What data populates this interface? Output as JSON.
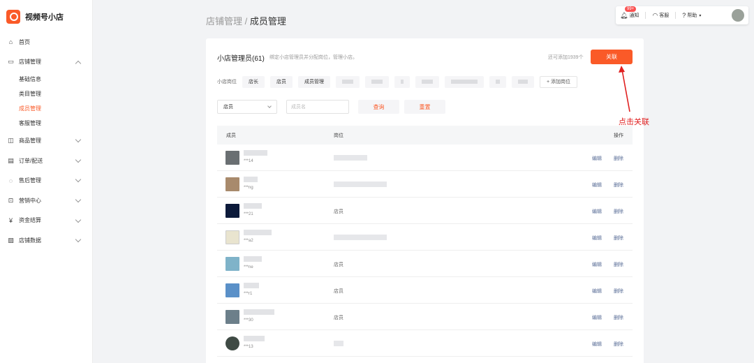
{
  "app": {
    "name": "视频号小店"
  },
  "sidebar": {
    "items": [
      {
        "label": "首页",
        "icon": "home-icon"
      },
      {
        "label": "店铺管理",
        "icon": "store-icon",
        "expanded": true,
        "children": [
          {
            "label": "基础信息",
            "active": false
          },
          {
            "label": "类目管理",
            "active": false
          },
          {
            "label": "成员管理",
            "active": true
          },
          {
            "label": "客服管理",
            "active": false
          }
        ]
      },
      {
        "label": "商品管理",
        "icon": "bag-icon"
      },
      {
        "label": "订单/配送",
        "icon": "order-icon"
      },
      {
        "label": "售后管理",
        "icon": "after-sale-icon"
      },
      {
        "label": "营销中心",
        "icon": "ticket-icon"
      },
      {
        "label": "资金结算",
        "icon": "yen-icon"
      },
      {
        "label": "店铺数据",
        "icon": "chart-icon"
      }
    ]
  },
  "breadcrumb": {
    "parent": "店铺管理",
    "separator": " / ",
    "current": "成员管理"
  },
  "topbar": {
    "notify_label": "通知",
    "notify_badge": "99+",
    "service_label": "客服",
    "help_label": "帮助"
  },
  "card": {
    "title": "小店管理员(61)",
    "desc": "绑定小店管理员并分配岗位，管理小店。",
    "remain": "还可添加1939个",
    "relate_button": "关联",
    "positions_label": "小店岗位",
    "positions": [
      "店长",
      "店员",
      "成员管理"
    ],
    "add_position": "+ 添加岗位",
    "filter": {
      "select_value": "店员",
      "input_placeholder": "成员名",
      "query_button": "查询",
      "reset_button": "重置"
    },
    "table": {
      "col_member": "成员",
      "col_position": "岗位",
      "col_action": "操作",
      "edit_label": "编辑",
      "delete_label": "删除",
      "rows": [
        {
          "suffix": "***14",
          "position": ""
        },
        {
          "suffix": "***ng",
          "position": ""
        },
        {
          "suffix": "***21",
          "position": "店员"
        },
        {
          "suffix": "***a2",
          "position": ""
        },
        {
          "suffix": "***ne",
          "position": "店员"
        },
        {
          "suffix": "***r1",
          "position": "店员"
        },
        {
          "suffix": "***30",
          "position": "店员"
        },
        {
          "suffix": "***13",
          "position": ""
        }
      ]
    }
  },
  "annotation": {
    "text": "点击关联",
    "color": "#e02020"
  },
  "colors": {
    "accent": "#fa5a28",
    "link": "#576b95"
  }
}
